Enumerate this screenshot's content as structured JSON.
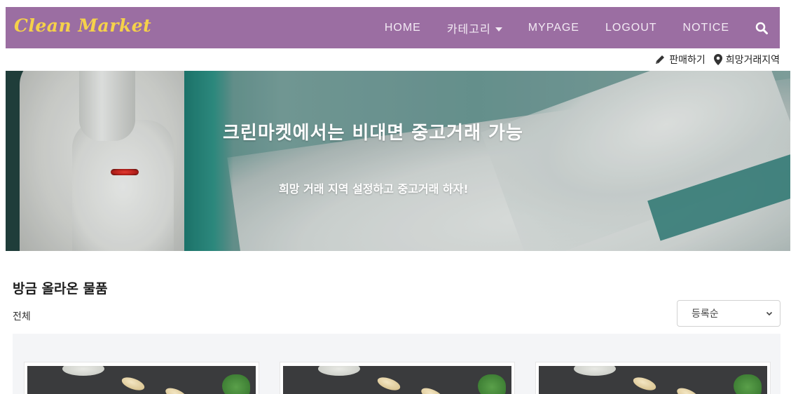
{
  "navbar": {
    "brand": "Clean Market",
    "items": [
      {
        "label": "HOME"
      },
      {
        "label": "카테고리",
        "has_caret": true
      },
      {
        "label": "MYPAGE"
      },
      {
        "label": "LOGOUT"
      },
      {
        "label": "NOTICE"
      }
    ],
    "search_icon": "search-icon"
  },
  "subbar": {
    "sell_label": "판매하기",
    "sell_icon": "pencil-icon",
    "region_label": "희망거래지역",
    "region_icon": "map-marker-icon"
  },
  "hero": {
    "title": "크린마켓에서는 비대면 중고거래 가능",
    "subtitle": "희망 거래 지역 설정하고 중고거래 하자!"
  },
  "section": {
    "title": "방금 올라온 물품",
    "filter_label": "전체",
    "sort_selected": "등록순"
  },
  "colors": {
    "navbar_bg": "#9b6ea2",
    "brand": "#f5d14a",
    "nav_text": "#f3eaf4"
  }
}
